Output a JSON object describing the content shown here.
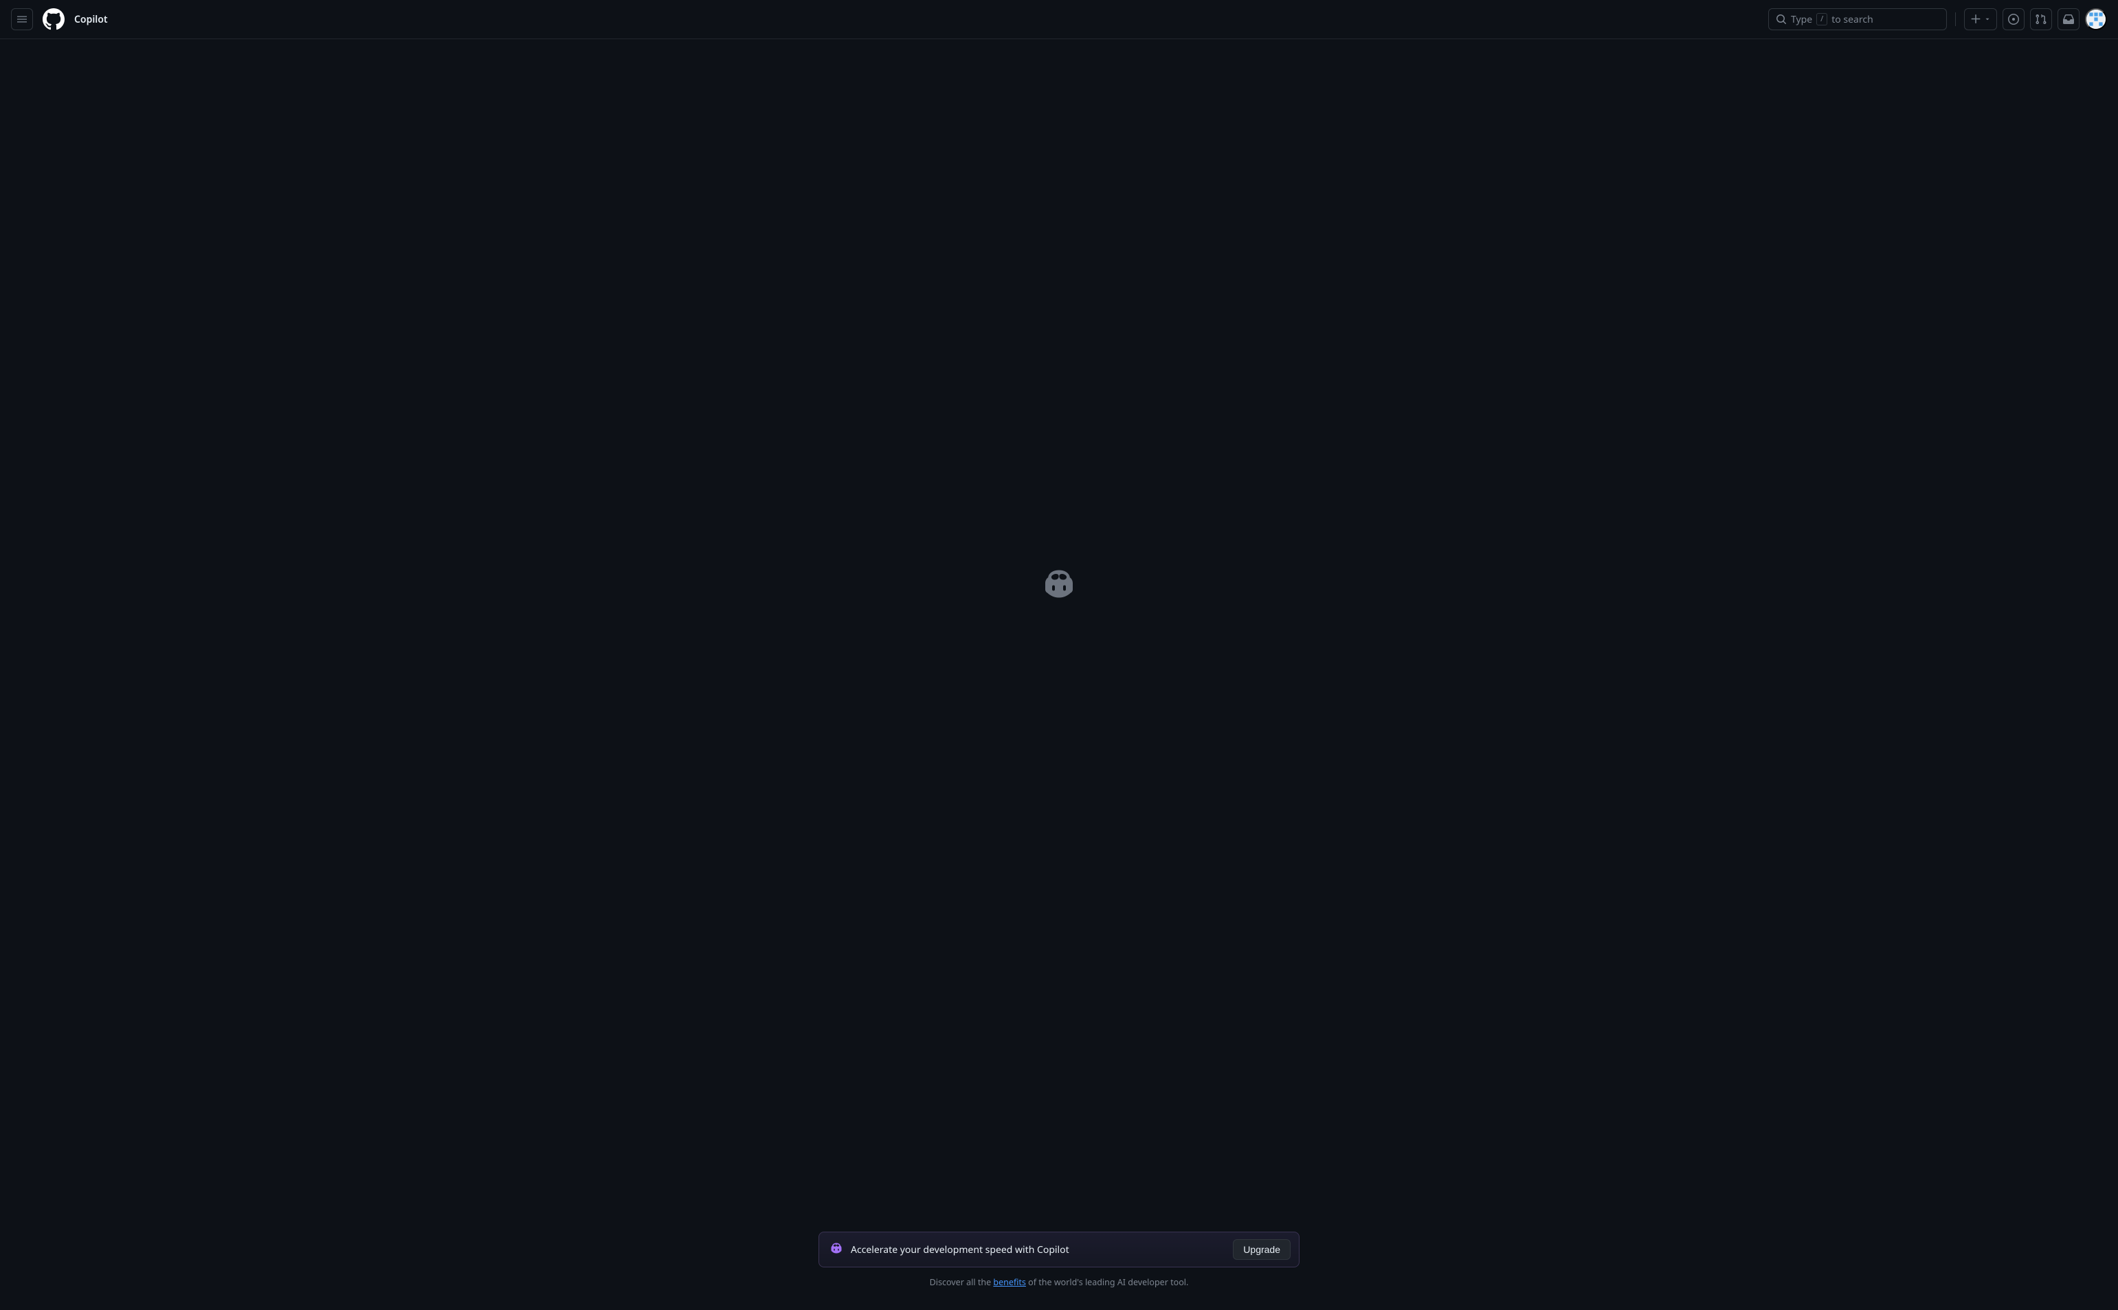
{
  "header": {
    "title": "Copilot",
    "search": {
      "prefix": "Type",
      "shortcut": "/",
      "suffix": "to search"
    }
  },
  "promo": {
    "text": "Accelerate your development speed with Copilot",
    "button": "Upgrade"
  },
  "footer": {
    "prefix": "Discover all the ",
    "link": "benefits",
    "suffix": " of the world's leading AI developer tool."
  }
}
